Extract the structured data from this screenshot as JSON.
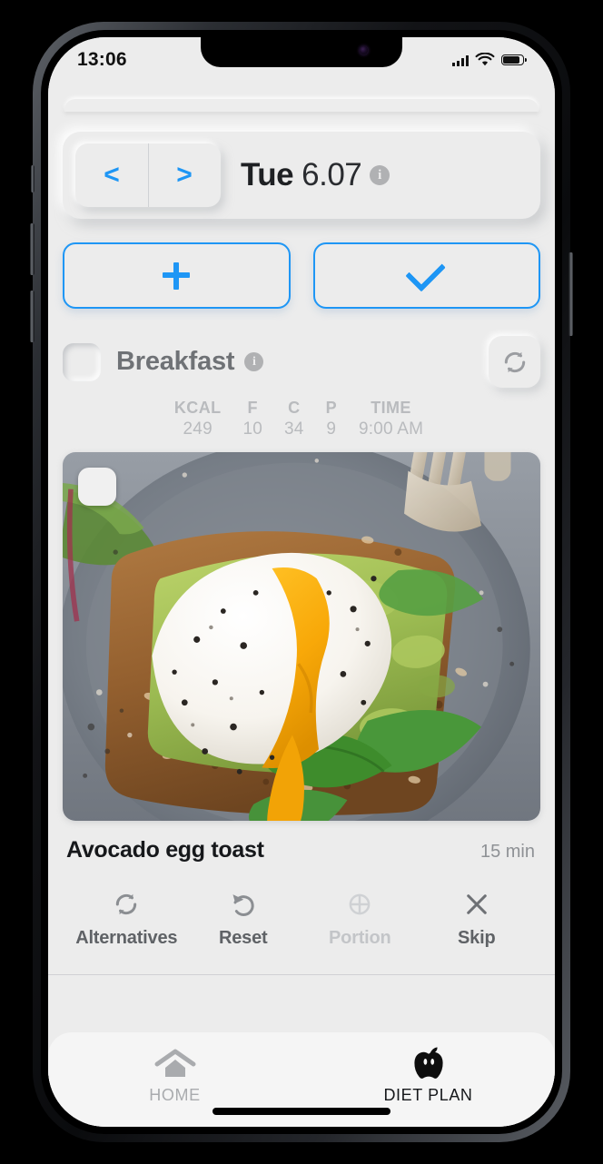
{
  "status_bar": {
    "time": "13:06",
    "signal_icon": "cellular-signal-icon",
    "wifi_icon": "wifi-icon",
    "battery_icon": "battery-icon"
  },
  "date_bar": {
    "prev_label": "<",
    "next_label": ">",
    "day_of_week": "Tue",
    "date": "6.07",
    "info_label": "i"
  },
  "actions": {
    "add_label": "+",
    "add_icon": "plus-icon",
    "confirm_label": "✓",
    "confirm_icon": "check-icon",
    "accent_color": "#1e96f5"
  },
  "meal": {
    "title": "Breakfast",
    "info_label": "i",
    "refresh_icon": "refresh-icon",
    "nutrition": [
      {
        "header": "KCAL",
        "value": "249"
      },
      {
        "header": "F",
        "value": "10"
      },
      {
        "header": "C",
        "value": "34"
      },
      {
        "header": "P",
        "value": "9"
      },
      {
        "header": "TIME",
        "value": "9:00 AM"
      }
    ],
    "photo_alt": "avocado-egg-toast-photo",
    "name": "Avocado egg toast",
    "duration": "15 min"
  },
  "tools": [
    {
      "label": "Alternatives",
      "icon": "refresh-icon",
      "disabled": false
    },
    {
      "label": "Reset",
      "icon": "undo-icon",
      "disabled": false
    },
    {
      "label": "Portion",
      "icon": "portion-pie-icon",
      "disabled": true
    },
    {
      "label": "Skip",
      "icon": "close-x-icon",
      "disabled": false
    }
  ],
  "tabbar": {
    "items": [
      {
        "label": "HOME",
        "icon": "home-icon",
        "active": false
      },
      {
        "label": "DIET PLAN",
        "icon": "apple-icon",
        "active": true
      }
    ]
  }
}
